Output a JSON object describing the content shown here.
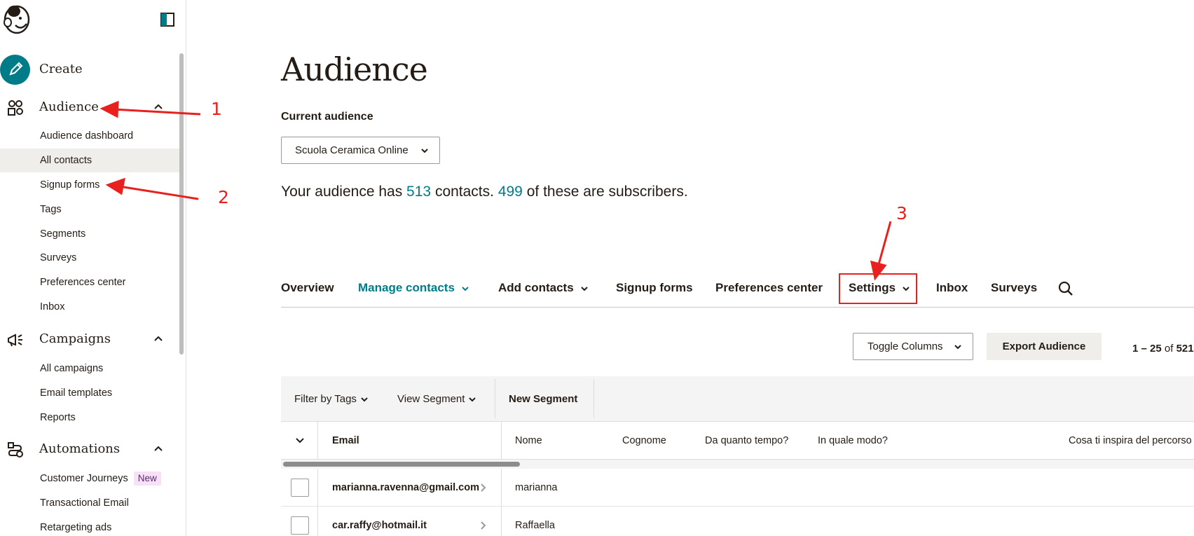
{
  "sidebar": {
    "sections": {
      "create": {
        "label": "Create",
        "icon": "pencil-icon"
      },
      "audience": {
        "label": "Audience",
        "icon": "audience-icon"
      },
      "campaigns": {
        "label": "Campaigns",
        "icon": "megaphone-icon"
      },
      "automations": {
        "label": "Automations",
        "icon": "automation-icon"
      }
    },
    "audience_items": [
      "Audience dashboard",
      "All contacts",
      "Signup forms",
      "Tags",
      "Segments",
      "Surveys",
      "Preferences center",
      "Inbox"
    ],
    "campaign_items": [
      "All campaigns",
      "Email templates",
      "Reports"
    ],
    "automation_items": [
      "Customer Journeys",
      "Transactional Email",
      "Retargeting ads"
    ],
    "new_badge": "New",
    "active_item": "All contacts"
  },
  "main": {
    "title": "Audience",
    "current_audience_label": "Current audience",
    "audience_select": "Scuola Ceramica Online",
    "summary": {
      "prefix": "Your audience has",
      "contacts": "513",
      "middle": "contacts.",
      "subscribers": "499",
      "suffix": "of these are subscribers."
    },
    "tabs": [
      "Overview",
      "Manage contacts",
      "Add contacts",
      "Signup forms",
      "Preferences center",
      "Settings",
      "Inbox",
      "Surveys"
    ],
    "toggle_columns": "Toggle Columns",
    "export_button": "Export Audience",
    "pager": {
      "range": "1 – 25",
      "of": "of",
      "total": "521"
    },
    "filters": {
      "filter_by_tags": "Filter by Tags",
      "view_segment": "View Segment",
      "new_segment": "New Segment"
    },
    "columns": [
      "Email",
      "Nome",
      "Cognome",
      "Da quanto tempo?",
      "In quale modo?",
      "Cosa ti inspira del percorso"
    ],
    "rows": [
      {
        "email": "marianna.ravenna@gmail.com",
        "nome": "marianna"
      },
      {
        "email": "car.raffy@hotmail.it",
        "nome": "Raffaella"
      }
    ]
  },
  "annotations": [
    "1",
    "2",
    "3"
  ],
  "colors": {
    "accent": "#007c89",
    "annotation_red": "#e8201e",
    "active_bg": "#efeeea"
  }
}
